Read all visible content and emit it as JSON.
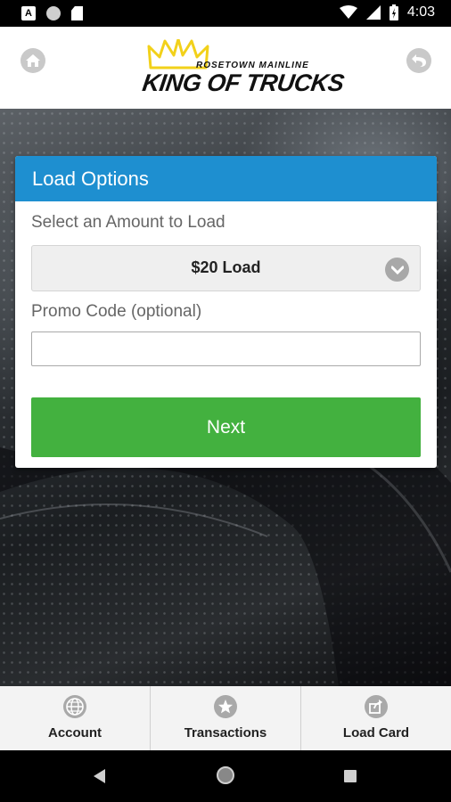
{
  "status_bar": {
    "time": "4:03",
    "notif_a": "A"
  },
  "header": {
    "logo_top": "ROSETOWN MAINLINE",
    "logo_main": "KING OF TRUCKS",
    "home_icon": "home-icon",
    "back_icon": "back-icon"
  },
  "card": {
    "title": "Load Options",
    "amount_label": "Select an Amount to Load",
    "amount_value": "$20 Load",
    "promo_label": "Promo Code (optional)",
    "promo_value": "",
    "next_label": "Next"
  },
  "bottom_nav": {
    "items": [
      {
        "label": "Account",
        "icon": "globe-icon"
      },
      {
        "label": "Transactions",
        "icon": "star-icon"
      },
      {
        "label": "Load Card",
        "icon": "share-icon"
      }
    ]
  },
  "colors": {
    "accent_blue": "#1e8fd0",
    "next_green": "#43b13f",
    "crown_yellow": "#f2d11a"
  }
}
